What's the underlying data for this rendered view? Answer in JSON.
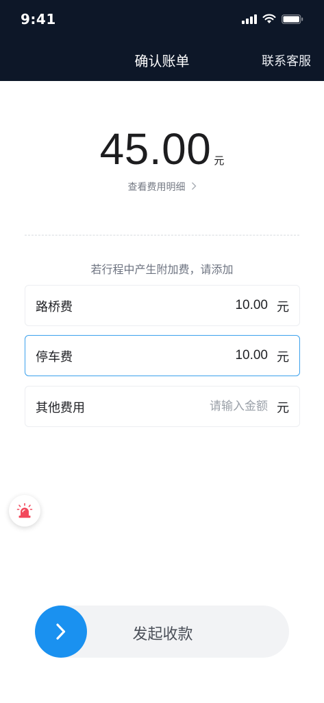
{
  "status_bar": {
    "time": "9:41"
  },
  "nav": {
    "title": "确认账单",
    "service": "联系客服"
  },
  "amount": {
    "value": "45.00",
    "unit": "元"
  },
  "detail_link": {
    "label": "查看费用明细"
  },
  "hint": "若行程中产生附加费，请添加",
  "fees": [
    {
      "label": "路桥费",
      "value": "10.00",
      "placeholder": "",
      "unit": "元"
    },
    {
      "label": "停车费",
      "value": "10.00",
      "placeholder": "",
      "unit": "元"
    },
    {
      "label": "其他费用",
      "value": "",
      "placeholder": "请输入金额",
      "unit": "元"
    }
  ],
  "slide": {
    "label": "发起收款"
  },
  "colors": {
    "nav_bg": "#0d1728",
    "accent": "#1a91f0",
    "active_border": "#3aa0ec",
    "alarm": "#f2495c"
  },
  "icons": {
    "signal": "cellular-signal-icon",
    "wifi": "wifi-icon",
    "battery": "battery-icon",
    "alarm": "alarm-siren-icon",
    "slide": "chevron-right-icon"
  }
}
